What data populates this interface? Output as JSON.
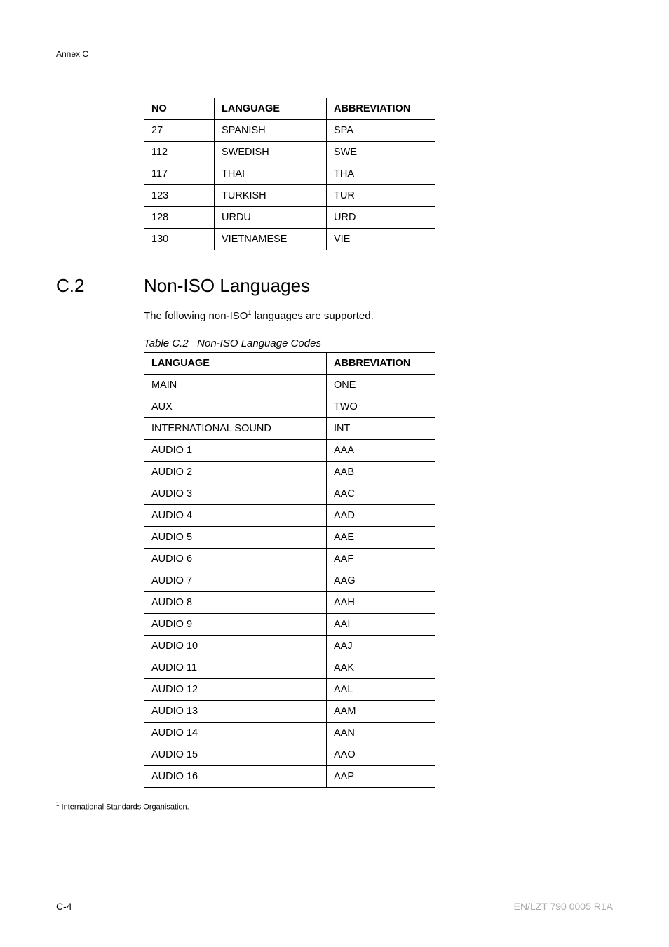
{
  "header": {
    "annex": "Annex C"
  },
  "table1": {
    "headers": [
      "NO",
      "LANGUAGE",
      "ABBREVIATION"
    ],
    "rows": [
      {
        "no": "27",
        "lang": "SPANISH",
        "abbr": "SPA"
      },
      {
        "no": "112",
        "lang": "SWEDISH",
        "abbr": "SWE"
      },
      {
        "no": "117",
        "lang": "THAI",
        "abbr": "THA"
      },
      {
        "no": "123",
        "lang": "TURKISH",
        "abbr": "TUR"
      },
      {
        "no": "128",
        "lang": "URDU",
        "abbr": "URD"
      },
      {
        "no": "130",
        "lang": "VIETNAMESE",
        "abbr": "VIE"
      }
    ]
  },
  "section": {
    "number": "C.2",
    "title": "Non-ISO Languages",
    "intro_pre": "The following non-ISO",
    "intro_sup": "1",
    "intro_post": " languages are supported."
  },
  "table2": {
    "caption_prefix": "Table C.2",
    "caption_title": "Non-ISO Language Codes",
    "headers": [
      "LANGUAGE",
      "ABBREVIATION"
    ],
    "rows": [
      {
        "lang": "MAIN",
        "abbr": "ONE"
      },
      {
        "lang": "AUX",
        "abbr": "TWO"
      },
      {
        "lang": "INTERNATIONAL SOUND",
        "abbr": "INT"
      },
      {
        "lang": "AUDIO 1",
        "abbr": "AAA"
      },
      {
        "lang": "AUDIO 2",
        "abbr": "AAB"
      },
      {
        "lang": "AUDIO 3",
        "abbr": "AAC"
      },
      {
        "lang": "AUDIO 4",
        "abbr": "AAD"
      },
      {
        "lang": "AUDIO 5",
        "abbr": "AAE"
      },
      {
        "lang": "AUDIO 6",
        "abbr": "AAF"
      },
      {
        "lang": "AUDIO 7",
        "abbr": "AAG"
      },
      {
        "lang": "AUDIO 8",
        "abbr": "AAH"
      },
      {
        "lang": "AUDIO 9",
        "abbr": "AAI"
      },
      {
        "lang": "AUDIO 10",
        "abbr": "AAJ"
      },
      {
        "lang": "AUDIO 11",
        "abbr": "AAK"
      },
      {
        "lang": "AUDIO 12",
        "abbr": "AAL"
      },
      {
        "lang": "AUDIO 13",
        "abbr": "AAM"
      },
      {
        "lang": "AUDIO 14",
        "abbr": "AAN"
      },
      {
        "lang": "AUDIO 15",
        "abbr": "AAO"
      },
      {
        "lang": "AUDIO 16",
        "abbr": "AAP"
      }
    ]
  },
  "footnote": {
    "marker": "1",
    "text": " International Standards Organisation."
  },
  "footer": {
    "left": "C-4",
    "right": "EN/LZT 790 0005 R1A"
  }
}
